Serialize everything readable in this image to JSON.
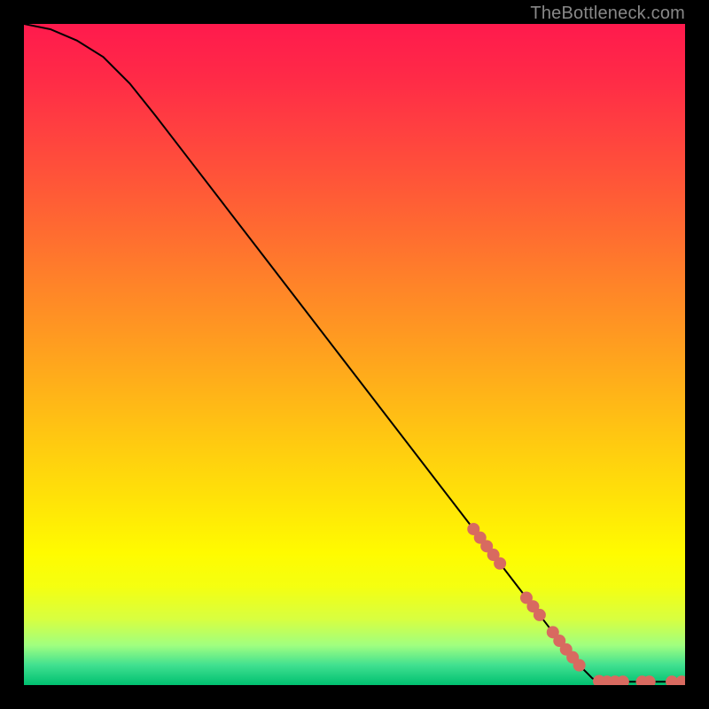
{
  "watermark": "TheBottleneck.com",
  "chart_data": {
    "type": "line",
    "title": "",
    "xlabel": "",
    "ylabel": "",
    "xlim": [
      0,
      1
    ],
    "ylim": [
      0,
      1
    ],
    "curve": [
      {
        "x": 0.0,
        "y": 1.0
      },
      {
        "x": 0.04,
        "y": 0.992
      },
      {
        "x": 0.08,
        "y": 0.975
      },
      {
        "x": 0.12,
        "y": 0.95
      },
      {
        "x": 0.16,
        "y": 0.91
      },
      {
        "x": 0.2,
        "y": 0.86
      },
      {
        "x": 0.25,
        "y": 0.795
      },
      {
        "x": 0.3,
        "y": 0.73
      },
      {
        "x": 0.35,
        "y": 0.665
      },
      {
        "x": 0.4,
        "y": 0.6
      },
      {
        "x": 0.45,
        "y": 0.535
      },
      {
        "x": 0.5,
        "y": 0.47
      },
      {
        "x": 0.55,
        "y": 0.405
      },
      {
        "x": 0.6,
        "y": 0.34
      },
      {
        "x": 0.65,
        "y": 0.275
      },
      {
        "x": 0.7,
        "y": 0.21
      },
      {
        "x": 0.75,
        "y": 0.145
      },
      {
        "x": 0.8,
        "y": 0.08
      },
      {
        "x": 0.84,
        "y": 0.03
      },
      {
        "x": 0.86,
        "y": 0.01
      },
      {
        "x": 0.88,
        "y": 0.005
      },
      {
        "x": 0.92,
        "y": 0.005
      },
      {
        "x": 0.96,
        "y": 0.005
      },
      {
        "x": 1.0,
        "y": 0.005
      }
    ],
    "dot_clusters": [
      {
        "x": 0.68,
        "y": 0.236,
        "r": 7
      },
      {
        "x": 0.69,
        "y": 0.223,
        "r": 7
      },
      {
        "x": 0.7,
        "y": 0.21,
        "r": 7
      },
      {
        "x": 0.71,
        "y": 0.197,
        "r": 7
      },
      {
        "x": 0.72,
        "y": 0.184,
        "r": 7
      },
      {
        "x": 0.76,
        "y": 0.132,
        "r": 7
      },
      {
        "x": 0.77,
        "y": 0.119,
        "r": 7
      },
      {
        "x": 0.78,
        "y": 0.106,
        "r": 7
      },
      {
        "x": 0.8,
        "y": 0.08,
        "r": 7
      },
      {
        "x": 0.81,
        "y": 0.067,
        "r": 7
      },
      {
        "x": 0.82,
        "y": 0.054,
        "r": 7
      },
      {
        "x": 0.83,
        "y": 0.042,
        "r": 7
      },
      {
        "x": 0.84,
        "y": 0.03,
        "r": 7
      },
      {
        "x": 0.87,
        "y": 0.006,
        "r": 7
      },
      {
        "x": 0.882,
        "y": 0.005,
        "r": 7
      },
      {
        "x": 0.894,
        "y": 0.005,
        "r": 7
      },
      {
        "x": 0.906,
        "y": 0.005,
        "r": 7
      },
      {
        "x": 0.935,
        "y": 0.005,
        "r": 7
      },
      {
        "x": 0.946,
        "y": 0.005,
        "r": 7
      },
      {
        "x": 0.98,
        "y": 0.005,
        "r": 7
      },
      {
        "x": 0.995,
        "y": 0.005,
        "r": 7
      }
    ],
    "dot_color": "#d86a60",
    "curve_color": "#000000"
  }
}
